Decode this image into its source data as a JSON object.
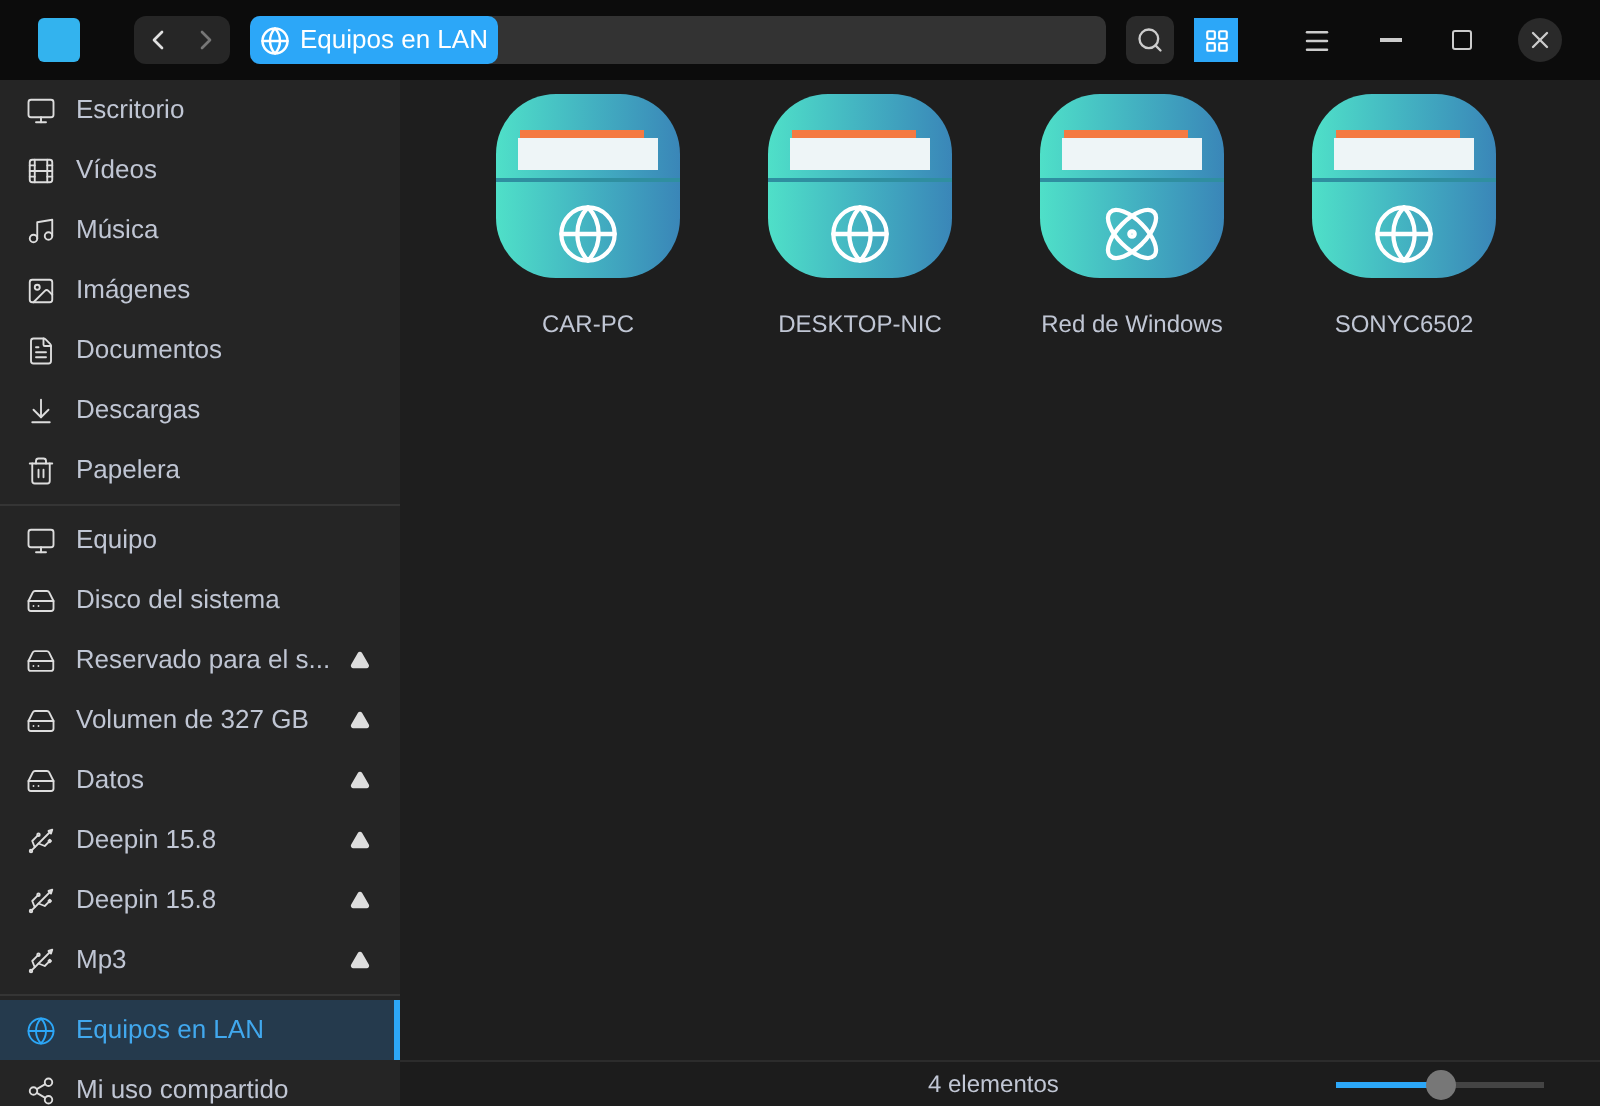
{
  "address_bar": {
    "location": "Equipos en LAN"
  },
  "toolbar": {
    "view_modes": [
      {
        "kind": "icons",
        "selected": true
      }
    ]
  },
  "sidebar": {
    "groups": [
      {
        "items": [
          {
            "label": "Escritorio",
            "kind": "desktop",
            "selected": false,
            "ejectable": false
          },
          {
            "label": "Vídeos",
            "kind": "video",
            "selected": false,
            "ejectable": false
          },
          {
            "label": "Música",
            "kind": "music",
            "selected": false,
            "ejectable": false
          },
          {
            "label": "Imágenes",
            "kind": "image",
            "selected": false,
            "ejectable": false
          },
          {
            "label": "Documentos",
            "kind": "document",
            "selected": false,
            "ejectable": false
          },
          {
            "label": "Descargas",
            "kind": "download",
            "selected": false,
            "ejectable": false
          },
          {
            "label": "Papelera",
            "kind": "trash",
            "selected": false,
            "ejectable": false
          }
        ]
      },
      {
        "items": [
          {
            "label": "Equipo",
            "kind": "computer",
            "selected": false,
            "ejectable": false
          },
          {
            "label": "Disco del sistema",
            "kind": "disk",
            "selected": false,
            "ejectable": false
          },
          {
            "label": "Reservado para el s...",
            "kind": "disk",
            "selected": false,
            "ejectable": true
          },
          {
            "label": "Volumen de 327 GB",
            "kind": "disk",
            "selected": false,
            "ejectable": true
          },
          {
            "label": "Datos",
            "kind": "disk",
            "selected": false,
            "ejectable": true
          },
          {
            "label": "Deepin 15.8",
            "kind": "usb",
            "selected": false,
            "ejectable": true
          },
          {
            "label": "Deepin 15.8",
            "kind": "usb",
            "selected": false,
            "ejectable": true
          },
          {
            "label": "Mp3",
            "kind": "usb",
            "selected": false,
            "ejectable": true
          }
        ]
      },
      {
        "items": [
          {
            "label": "Equipos en LAN",
            "kind": "network",
            "selected": true,
            "ejectable": false
          },
          {
            "label": "Mi uso compartido",
            "kind": "share",
            "selected": false,
            "ejectable": false
          }
        ]
      }
    ]
  },
  "files": [
    {
      "name": "CAR-PC",
      "kind": "globe"
    },
    {
      "name": "DESKTOP-NIC",
      "kind": "globe"
    },
    {
      "name": "Red de Windows",
      "kind": "atom"
    },
    {
      "name": "SONYC6502",
      "kind": "globe"
    }
  ],
  "status_bar": {
    "count": "4 elementos",
    "zoom": {
      "level": 0.5
    }
  }
}
